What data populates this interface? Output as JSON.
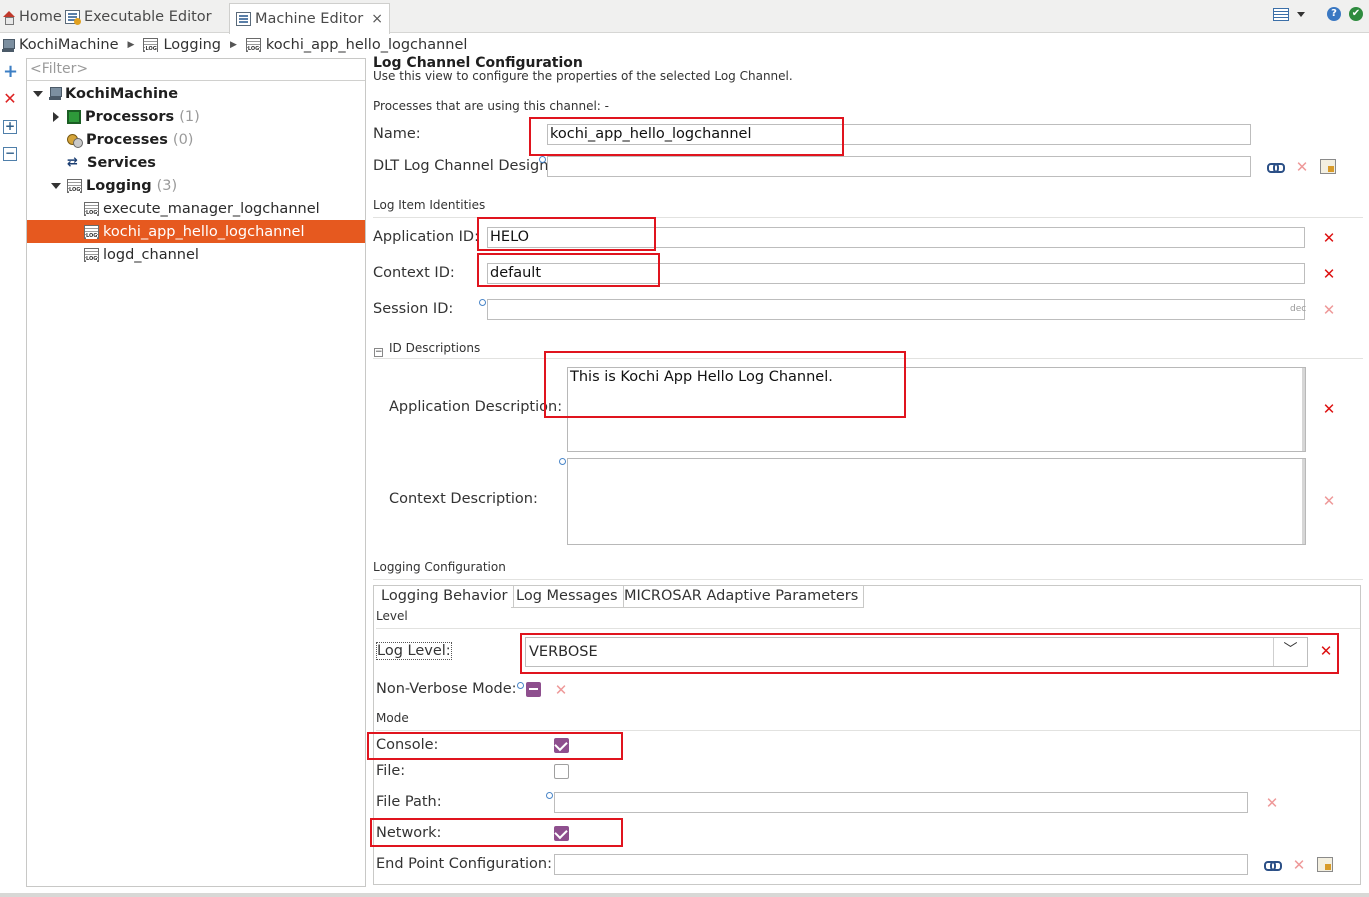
{
  "tabs": {
    "home": "Home",
    "executable_editor": "Executable Editor",
    "machine_editor": "Machine Editor",
    "close_glyph": "×"
  },
  "breadcrumb": [
    "KochiMachine",
    "Logging",
    "kochi_app_hello_logchannel"
  ],
  "tree": {
    "filter_placeholder": "<Filter>",
    "root": "KochiMachine",
    "nodes": [
      {
        "label": "Processors",
        "count": "(1)"
      },
      {
        "label": "Processes",
        "count": "(0)"
      },
      {
        "label": "Services",
        "count": ""
      },
      {
        "label": "Logging",
        "count": "(3)"
      }
    ],
    "logging_children": [
      "execute_manager_logchannel",
      "kochi_app_hello_logchannel",
      "logd_channel"
    ],
    "selected": "kochi_app_hello_logchannel"
  },
  "form": {
    "title": "Log Channel Configuration",
    "description": "Use this view to configure the properties of the selected Log Channel.",
    "processes_using": "Processes that are using this channel: -",
    "name_label": "Name:",
    "name_value": "kochi_app_hello_logchannel",
    "dlt_label": "DLT Log Channel Design:",
    "dlt_value": "",
    "log_item_identities": "Log Item Identities",
    "application_id_label": "Application ID:",
    "application_id_value": "HELO",
    "context_id_label": "Context ID:",
    "context_id_value": "default",
    "session_id_label": "Session ID:",
    "session_id_value": "",
    "session_id_suffix": "dec",
    "id_descriptions": "ID Descriptions",
    "application_description_label": "Application Description:",
    "application_description_value": "This is Kochi App Hello Log Channel.",
    "context_description_label": "Context Description:",
    "context_description_value": "",
    "logging_configuration": "Logging Configuration",
    "subtabs": [
      "Logging Behavior",
      "Log Messages",
      "MICROSAR Adaptive Parameters"
    ],
    "level_heading": "Level",
    "log_level_label": "Log Level:",
    "log_level_value": "VERBOSE",
    "non_verbose_label": "Non-Verbose Mode:",
    "mode_heading": "Mode",
    "console_label": "Console:",
    "console_checked": true,
    "file_label": "File:",
    "file_checked": false,
    "file_path_label": "File Path:",
    "file_path_value": "",
    "network_label": "Network:",
    "network_checked": true,
    "endpoint_label": "End Point Configuration:",
    "endpoint_value": ""
  },
  "icons": {
    "remove": "✕",
    "dropdown": "﹀",
    "collapse": "−",
    "expand_tree": "+",
    "tree_arrow": "⇄"
  },
  "colors": {
    "selection": "#e6591f",
    "highlight_border": "#e0141e",
    "checkbox": "#8e4f8e"
  }
}
